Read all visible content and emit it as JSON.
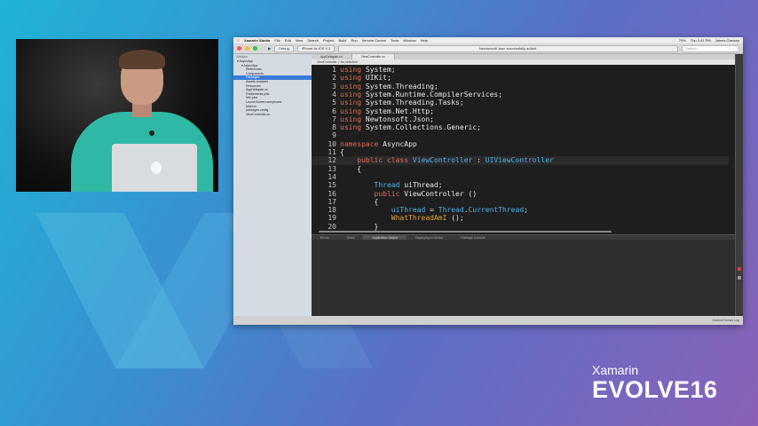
{
  "colors": {
    "bg_start": "#1fb3d6",
    "bg_end": "#8a62b8",
    "editor_bg": "#1e1e1e",
    "keyword": "#e06c5a",
    "type": "#4fb3e8",
    "method": "#e0a040",
    "selection": "#3b7bd8"
  },
  "menubar": {
    "app": "Xamarin Studio",
    "items": [
      "File",
      "Edit",
      "View",
      "Search",
      "Project",
      "Build",
      "Run",
      "Version Control",
      "Tools",
      "Window",
      "Help"
    ],
    "battery": "79%",
    "clock": "Thu 2:41 PM",
    "user": "James Clancey"
  },
  "toolbar": {
    "config": "Debug",
    "device": "iPhone 6s iOS 9.3",
    "status": "Newtonsoft.Json successfully added.",
    "search_placeholder": "Search"
  },
  "sidebar": {
    "title": "Solution",
    "items": [
      {
        "label": "AsyncApp",
        "indent": 0,
        "selected": false
      },
      {
        "label": "AsyncApp",
        "indent": 1,
        "selected": false
      },
      {
        "label": "References",
        "indent": 2,
        "selected": false
      },
      {
        "label": "Components",
        "indent": 2,
        "selected": false
      },
      {
        "label": "Packages",
        "indent": 2,
        "selected": true
      },
      {
        "label": "Assets.xcassets",
        "indent": 2,
        "selected": false
      },
      {
        "label": "Resources",
        "indent": 2,
        "selected": false
      },
      {
        "label": "AppDelegate.cs",
        "indent": 2,
        "selected": false
      },
      {
        "label": "Entitlements.plist",
        "indent": 2,
        "selected": false
      },
      {
        "label": "Info.plist",
        "indent": 2,
        "selected": false
      },
      {
        "label": "LaunchScreen.storyboard",
        "indent": 2,
        "selected": false
      },
      {
        "label": "Main.cs",
        "indent": 2,
        "selected": false
      },
      {
        "label": "packages.config",
        "indent": 2,
        "selected": false
      },
      {
        "label": "ViewController.cs",
        "indent": 2,
        "selected": false
      }
    ]
  },
  "doc_tabs": [
    "AppDelegate.cs",
    "ViewController.cs"
  ],
  "breadcrumb": "ViewController  >  No selection",
  "code": [
    {
      "n": "1",
      "tokens": [
        {
          "t": "using",
          "c": "kw"
        },
        {
          "t": " System;",
          "c": "pl"
        }
      ]
    },
    {
      "n": "2",
      "tokens": [
        {
          "t": "using",
          "c": "kw"
        },
        {
          "t": " UIKit;",
          "c": "pl"
        }
      ]
    },
    {
      "n": "3",
      "tokens": [
        {
          "t": "using",
          "c": "kw"
        },
        {
          "t": " System.Threading;",
          "c": "pl"
        }
      ]
    },
    {
      "n": "4",
      "tokens": [
        {
          "t": "using",
          "c": "kw"
        },
        {
          "t": " System.Runtime.CompilerServices;",
          "c": "pl"
        }
      ]
    },
    {
      "n": "5",
      "tokens": [
        {
          "t": "using",
          "c": "kw"
        },
        {
          "t": " System.Threading.Tasks;",
          "c": "pl"
        }
      ]
    },
    {
      "n": "6",
      "tokens": [
        {
          "t": "using",
          "c": "kw"
        },
        {
          "t": " System.Net.Http;",
          "c": "pl"
        }
      ]
    },
    {
      "n": "7",
      "tokens": [
        {
          "t": "using",
          "c": "kw"
        },
        {
          "t": " Newtonsoft.Json;",
          "c": "pl"
        }
      ]
    },
    {
      "n": "8",
      "tokens": [
        {
          "t": "using",
          "c": "kw"
        },
        {
          "t": " System.Collections.Generic;",
          "c": "pl"
        }
      ]
    },
    {
      "n": "9",
      "tokens": []
    },
    {
      "n": "10",
      "tokens": [
        {
          "t": "namespace",
          "c": "kw"
        },
        {
          "t": " AsyncApp",
          "c": "pl"
        }
      ]
    },
    {
      "n": "11",
      "tokens": [
        {
          "t": "{",
          "c": "pl"
        }
      ]
    },
    {
      "n": "12",
      "tokens": [
        {
          "t": "    public class ",
          "c": "kw"
        },
        {
          "t": "ViewController",
          "c": "ty"
        },
        {
          "t": " : ",
          "c": "pl"
        },
        {
          "t": "UIViewController",
          "c": "ty"
        }
      ],
      "hl": true
    },
    {
      "n": "13",
      "tokens": [
        {
          "t": "    {",
          "c": "pl"
        }
      ]
    },
    {
      "n": "14",
      "tokens": []
    },
    {
      "n": "15",
      "tokens": [
        {
          "t": "        Thread",
          "c": "ty"
        },
        {
          "t": " uiThread;",
          "c": "pl"
        }
      ]
    },
    {
      "n": "16",
      "tokens": [
        {
          "t": "        public",
          "c": "kw"
        },
        {
          "t": " ViewController ()",
          "c": "pl"
        }
      ]
    },
    {
      "n": "17",
      "tokens": [
        {
          "t": "        {",
          "c": "pl"
        }
      ]
    },
    {
      "n": "18",
      "tokens": [
        {
          "t": "            uiThread",
          "c": "ty"
        },
        {
          "t": " = ",
          "c": "pl"
        },
        {
          "t": "Thread",
          "c": "ty"
        },
        {
          "t": ".",
          "c": "pl"
        },
        {
          "t": "CurrentThread",
          "c": "ty"
        },
        {
          "t": ";",
          "c": "pl"
        }
      ]
    },
    {
      "n": "19",
      "tokens": [
        {
          "t": "            WhatThreadAmI",
          "c": "fn"
        },
        {
          "t": " ();",
          "c": "pl"
        }
      ]
    },
    {
      "n": "20",
      "tokens": [
        {
          "t": "        }",
          "c": "pl"
        }
      ]
    }
  ],
  "pad_tabs": [
    "Errors",
    "Tasks",
    "Application Output",
    "Deploying to Device",
    "Package Console"
  ],
  "active_pad_tab": 2,
  "status_right": "Android Device Log",
  "brand": {
    "line1": "Xamarin",
    "line2": "EVOLVE16"
  }
}
